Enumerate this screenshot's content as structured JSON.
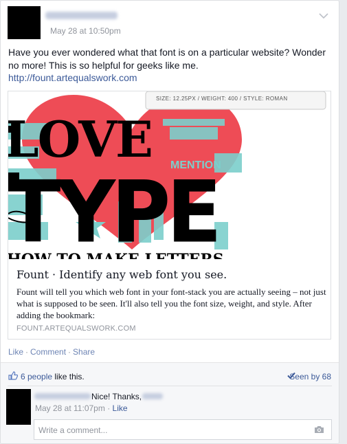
{
  "post": {
    "timestamp": "May 28 at 10:50pm",
    "text": "Have you ever wondered what that font is on a particular website? Wonder no more! This is so helpful for geeks like me.",
    "link": "http://fount.artequalswork.com"
  },
  "preview": {
    "image": {
      "tooltip": "SIZE: 12.25PX / WEIGHT: 400 / STYLE: ROMAN",
      "word_love": "LOVE",
      "word_type": "TYPE",
      "word_how": "HOW TO MAKE LETTERS",
      "word_mention": "MENTION",
      "colors": {
        "heart": "#ee4c56",
        "teal": "#7ccfcc",
        "ink": "#000000"
      }
    },
    "title": "Fount · Identify any web font you see.",
    "description": "Fount will tell you which web font in your font-stack you are actually seeing – not just what is supposed to be seen. It'll also tell you the font size, weight, and style. After adding the bookmark:",
    "domain": "FOUNT.ARTEQUALSWORK.COM"
  },
  "actions": {
    "like": "Like",
    "comment": "Comment",
    "share": "Share",
    "separator": "·"
  },
  "feedback": {
    "likes_count": "6 people",
    "likes_suffix": "like this.",
    "seen_by": "Seen by 68"
  },
  "comment": {
    "text": "Nice! Thanks,",
    "time": "May 28 at 11:07pm",
    "separator": "·",
    "like": "Like"
  },
  "reply": {
    "placeholder": "Write a comment..."
  },
  "icons": {
    "chevron": "chevron-down-icon",
    "thumb": "thumbs-up-icon",
    "check": "check-icon",
    "camera": "camera-icon"
  },
  "theme": {
    "link_blue": "#3b5998",
    "muted_gray": "#90949c",
    "action_blue": "#6d84b4"
  }
}
